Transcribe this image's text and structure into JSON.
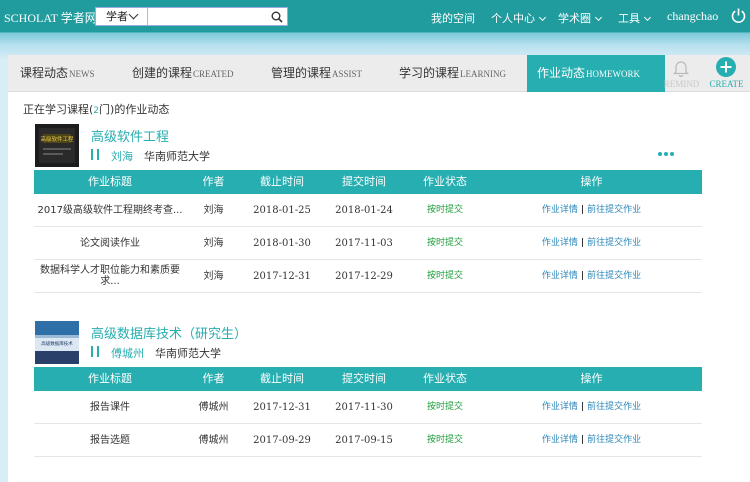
{
  "topbar": {
    "brand": "SCHOLAT 学者网",
    "search": {
      "type_label": "学者",
      "value": "",
      "placeholder": ""
    },
    "nav": {
      "my_space": "我的空间",
      "personal_center": "个人中心",
      "academic_circle": "学术圈",
      "tools": "工具",
      "username": "changchao"
    }
  },
  "tabs": [
    {
      "cn": "课程动态",
      "en": "NEWS",
      "active": false
    },
    {
      "cn": "创建的课程",
      "en": "CREATED",
      "active": false
    },
    {
      "cn": "管理的课程",
      "en": "ASSIST",
      "active": false
    },
    {
      "cn": "学习的课程",
      "en": "LEARNING",
      "active": false
    },
    {
      "cn": "作业动态",
      "en": "HOMEWORK",
      "active": true
    }
  ],
  "tools": {
    "remind": "REMIND",
    "create": "CREATE"
  },
  "intro": {
    "prefix": "正在学习课程(",
    "count": "2",
    "suffix": "门)的作业动态"
  },
  "columns": [
    "作业标题",
    "作者",
    "截止时间",
    "提交时间",
    "作业状态",
    "操作"
  ],
  "courses": [
    {
      "title": "高级软件工程",
      "teacher": "刘海",
      "school": "华南师范大学",
      "thumb_text": "高级软件工程",
      "rows": [
        {
          "title": "2017级高级软件工程期终考查...",
          "author": "刘海",
          "deadline": "2018-01-25",
          "submitted": "2018-01-24",
          "status": "按时提交",
          "op1": "作业详情",
          "sep": "|",
          "op2": "前往提交作业"
        },
        {
          "title": "论文阅读作业",
          "author": "刘海",
          "deadline": "2018-01-30",
          "submitted": "2017-11-03",
          "status": "按时提交",
          "op1": "作业详情",
          "sep": "|",
          "op2": "前往提交作业"
        },
        {
          "title": "数据科学人才职位能力和素质要求...",
          "author": "刘海",
          "deadline": "2017-12-31",
          "submitted": "2017-12-29",
          "status": "按时提交",
          "op1": "作业详情",
          "sep": "|",
          "op2": "前往提交作业"
        }
      ]
    },
    {
      "title": "高级数据库技术（研究生）",
      "teacher": "傅城州",
      "school": "华南师范大学",
      "thumb_text": "高级数据库技术",
      "rows": [
        {
          "title": "报告课件",
          "author": "傅城州",
          "deadline": "2017-12-31",
          "submitted": "2017-11-30",
          "status": "按时提交",
          "op1": "作业详情",
          "sep": "|",
          "op2": "前往提交作业"
        },
        {
          "title": "报告选题",
          "author": "傅城州",
          "deadline": "2017-09-29",
          "submitted": "2017-09-15",
          "status": "按时提交",
          "op1": "作业详情",
          "sep": "|",
          "op2": "前往提交作业"
        }
      ]
    }
  ],
  "colors": {
    "teal": "#27aeb0",
    "topbar": "#219c9e",
    "status_green": "#1d9c3a",
    "link_blue": "#2a86b8"
  }
}
